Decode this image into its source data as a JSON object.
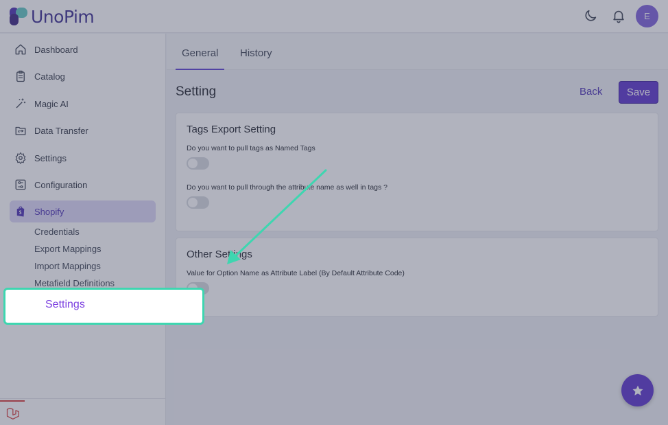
{
  "app": {
    "name": "UnoPim",
    "avatar_letter": "E"
  },
  "header": {
    "icons": [
      "moon-icon",
      "bell-icon"
    ]
  },
  "sidebar": {
    "items": [
      {
        "label": "Dashboard",
        "icon": "home-icon"
      },
      {
        "label": "Catalog",
        "icon": "clipboard-icon"
      },
      {
        "label": "Magic AI",
        "icon": "magic-wand-icon"
      },
      {
        "label": "Data Transfer",
        "icon": "folder-transfer-icon"
      },
      {
        "label": "Settings",
        "icon": "gear-icon"
      },
      {
        "label": "Configuration",
        "icon": "sliders-icon"
      },
      {
        "label": "Shopify",
        "icon": "shopify-bag-icon",
        "active": true
      }
    ],
    "sub_items": [
      "Credentials",
      "Export Mappings",
      "Import Mappings",
      "Metafield Definitions"
    ]
  },
  "tabs": [
    {
      "label": "General",
      "active": true
    },
    {
      "label": "History",
      "active": false
    }
  ],
  "page": {
    "title": "Setting",
    "back_label": "Back",
    "save_label": "Save"
  },
  "cards": {
    "tags": {
      "title": "Tags Export Setting",
      "field1": "Do you want to pull tags as Named Tags",
      "field2": "Do you want to pull through the attribute name as well in tags ?"
    },
    "other": {
      "title": "Other Settings",
      "field1": "Value for Option Name as Attribute Label (By Default Attribute Code)"
    }
  },
  "callout": {
    "label": "Settings"
  },
  "colors": {
    "accent": "#5a33cc",
    "callout_border": "#3ed6b0",
    "callout_text": "#7b3fe0",
    "arrow": "#3ed6b0"
  }
}
